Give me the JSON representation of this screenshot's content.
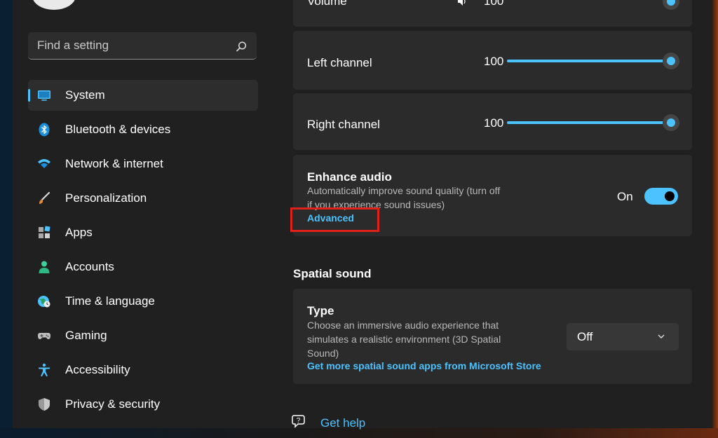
{
  "search": {
    "placeholder": "Find a setting"
  },
  "sidebar": {
    "items": [
      {
        "label": "System",
        "icon": "monitor-icon"
      },
      {
        "label": "Bluetooth & devices",
        "icon": "bluetooth-icon"
      },
      {
        "label": "Network & internet",
        "icon": "wifi-icon"
      },
      {
        "label": "Personalization",
        "icon": "brush-icon"
      },
      {
        "label": "Apps",
        "icon": "apps-icon"
      },
      {
        "label": "Accounts",
        "icon": "person-icon"
      },
      {
        "label": "Time & language",
        "icon": "globe-clock-icon"
      },
      {
        "label": "Gaming",
        "icon": "gamepad-icon"
      },
      {
        "label": "Accessibility",
        "icon": "accessibility-icon"
      },
      {
        "label": "Privacy & security",
        "icon": "shield-icon"
      }
    ],
    "selected": "System"
  },
  "volume": {
    "label": "Volume",
    "value": "100"
  },
  "left_channel": {
    "label": "Left channel",
    "value": "100",
    "level_percent": 100
  },
  "right_channel": {
    "label": "Right channel",
    "value": "100",
    "level_percent": 100
  },
  "enhance_audio": {
    "title": "Enhance audio",
    "description_line1": "Automatically improve sound quality (turn off",
    "description_line2": "if you experience sound issues)",
    "toggle_state": "On",
    "link": "Advanced"
  },
  "spatial_sound": {
    "section_title": "Spatial sound",
    "type_title": "Type",
    "description_line1": "Choose an immersive audio experience that",
    "description_line2": "simulates a realistic environment (3D Spatial",
    "description_line3": "Sound)",
    "store_link": "Get more spatial sound apps from Microsoft Store",
    "dropdown_value": "Off"
  },
  "help": {
    "label": "Get help"
  },
  "colors": {
    "accent": "#4cc2ff",
    "highlight": "#e0201b",
    "card": "#2b2b2b",
    "background": "#202020"
  }
}
